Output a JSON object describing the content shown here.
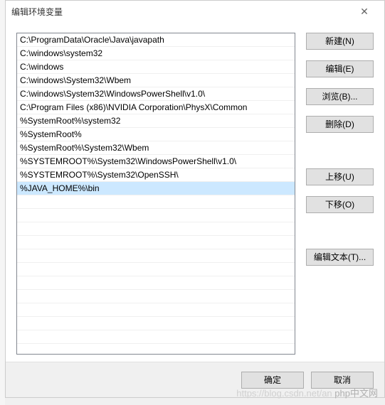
{
  "titlebar": {
    "title": "编辑环境变量",
    "close_icon": "✕"
  },
  "list": {
    "items": [
      "C:\\ProgramData\\Oracle\\Java\\javapath",
      "C:\\windows\\system32",
      "C:\\windows",
      "C:\\windows\\System32\\Wbem",
      "C:\\windows\\System32\\WindowsPowerShell\\v1.0\\",
      "C:\\Program Files (x86)\\NVIDIA Corporation\\PhysX\\Common",
      "%SystemRoot%\\system32",
      "%SystemRoot%",
      "%SystemRoot%\\System32\\Wbem",
      "%SYSTEMROOT%\\System32\\WindowsPowerShell\\v1.0\\",
      "%SYSTEMROOT%\\System32\\OpenSSH\\",
      "%JAVA_HOME%\\bin"
    ],
    "selected_index": 11
  },
  "buttons": {
    "new": "新建(N)",
    "edit": "编辑(E)",
    "browse": "浏览(B)...",
    "delete": "删除(D)",
    "move_up": "上移(U)",
    "move_down": "下移(O)",
    "edit_text": "编辑文本(T)...",
    "ok": "确定",
    "cancel": "取消"
  },
  "watermark": {
    "url": "https://blog.csdn.net/an",
    "brand": "php中文网"
  }
}
